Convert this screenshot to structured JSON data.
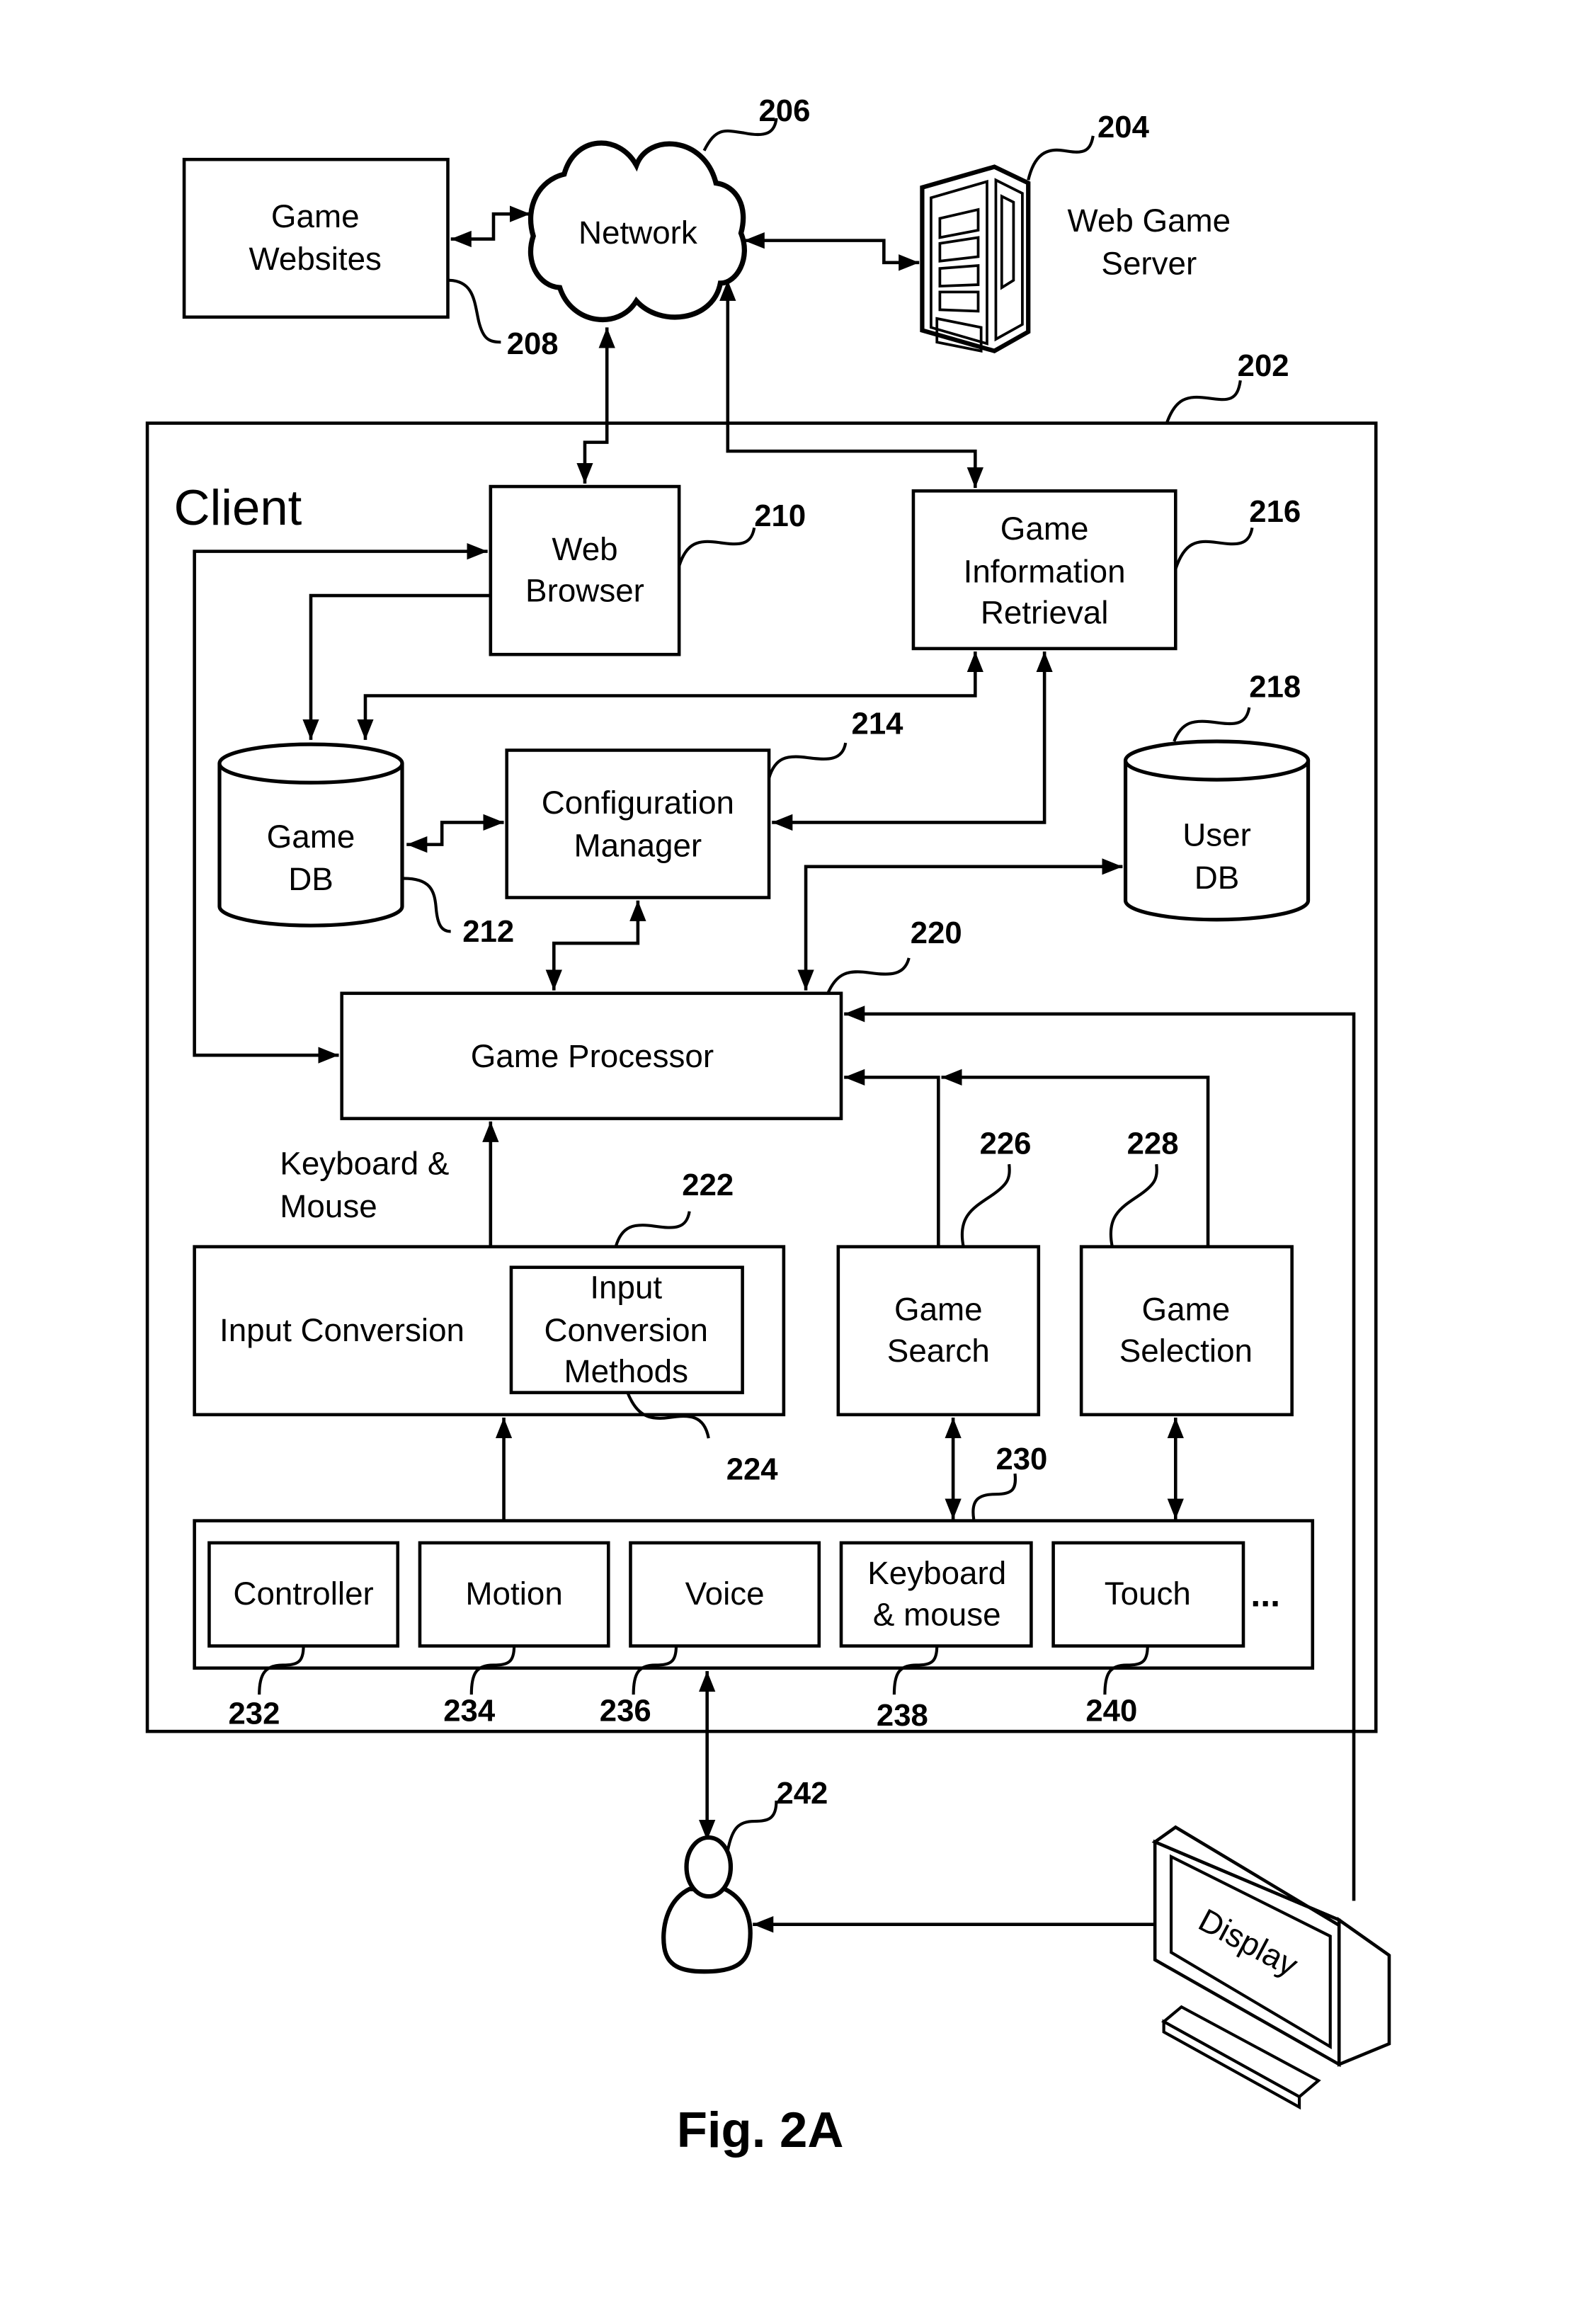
{
  "figure": {
    "caption": "Fig. 2A",
    "client_label": "Client",
    "nodes": {
      "game_websites": {
        "lines": [
          "Game",
          "Websites"
        ],
        "ref": "208"
      },
      "network": {
        "lines": [
          "Network"
        ],
        "ref": "206"
      },
      "web_game_server": {
        "lines": [
          "Web Game",
          "Server"
        ],
        "ref": "204"
      },
      "client": {
        "ref": "202"
      },
      "web_browser": {
        "lines": [
          "Web",
          "Browser"
        ],
        "ref": "210"
      },
      "game_info_retrieval": {
        "lines": [
          "Game",
          "Information",
          "Retrieval"
        ],
        "ref": "216"
      },
      "game_db": {
        "lines": [
          "Game",
          "DB"
        ],
        "ref": "212"
      },
      "configuration_manager": {
        "lines": [
          "Configuration",
          "Manager"
        ],
        "ref": "214"
      },
      "user_db": {
        "lines": [
          "User",
          "DB"
        ],
        "ref": "218"
      },
      "game_processor": {
        "lines": [
          "Game Processor"
        ],
        "ref": "220"
      },
      "keyboard_mouse_label": {
        "lines": [
          "Keyboard &",
          "Mouse"
        ]
      },
      "input_conversion": {
        "lines": [
          "Input Conversion"
        ],
        "ref": "222"
      },
      "input_conversion_methods": {
        "lines": [
          "Input",
          "Conversion",
          "Methods"
        ],
        "ref": "224"
      },
      "game_search": {
        "lines": [
          "Game",
          "Search"
        ],
        "ref": "226"
      },
      "game_selection": {
        "lines": [
          "Game",
          "Selection"
        ],
        "ref": "228"
      },
      "input_devices": {
        "ref": "230",
        "ellipsis": "..."
      },
      "controller": {
        "lines": [
          "Controller"
        ],
        "ref": "232"
      },
      "motion": {
        "lines": [
          "Motion"
        ],
        "ref": "234"
      },
      "voice": {
        "lines": [
          "Voice"
        ],
        "ref": "236"
      },
      "keyboard_and_mouse": {
        "lines": [
          "Keyboard",
          "& mouse"
        ],
        "ref": "238"
      },
      "touch": {
        "lines": [
          "Touch"
        ],
        "ref": "240"
      },
      "user": {
        "ref": "242"
      },
      "display": {
        "lines": [
          "Display"
        ]
      }
    }
  }
}
